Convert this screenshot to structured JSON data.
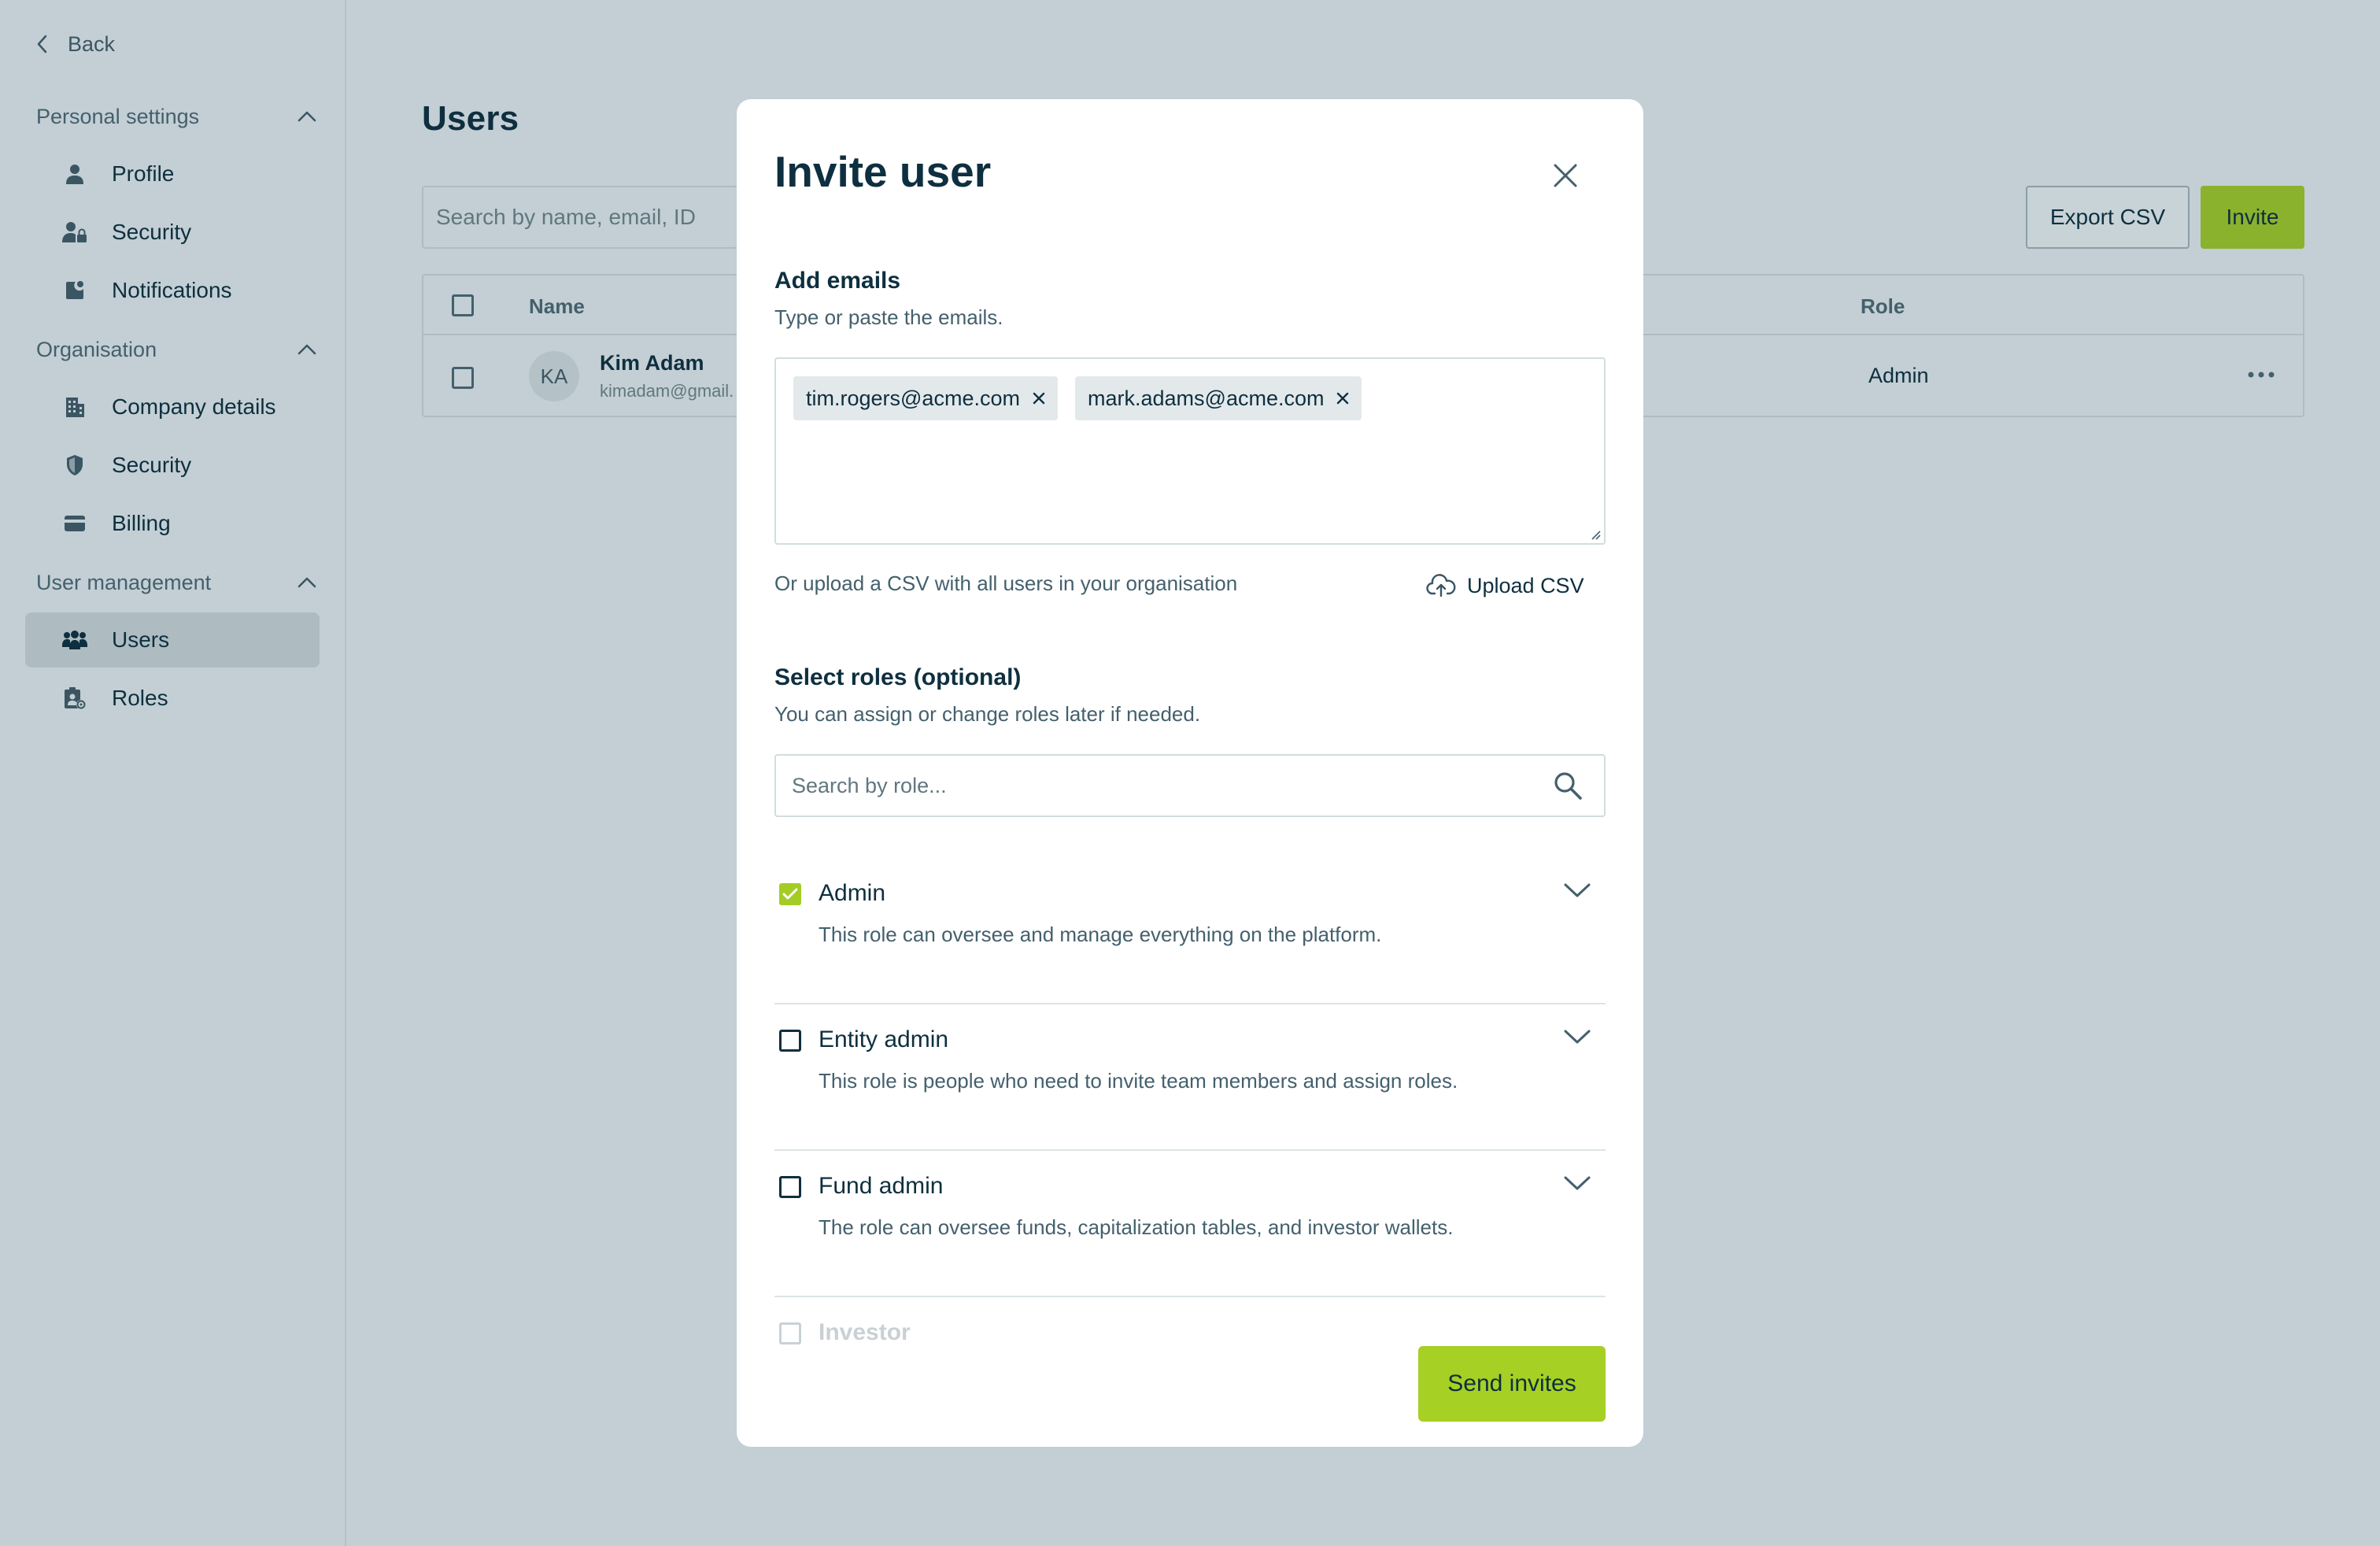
{
  "sidebar": {
    "back_label": "Back",
    "sections": [
      {
        "title": "Personal settings",
        "items": [
          {
            "label": "Profile",
            "icon": "person-icon"
          },
          {
            "label": "Security",
            "icon": "user-lock-icon"
          },
          {
            "label": "Notifications",
            "icon": "notification-icon"
          }
        ]
      },
      {
        "title": "Organisation",
        "items": [
          {
            "label": "Company details",
            "icon": "building-icon"
          },
          {
            "label": "Security",
            "icon": "shield-icon"
          },
          {
            "label": "Billing",
            "icon": "card-icon"
          }
        ]
      },
      {
        "title": "User management",
        "items": [
          {
            "label": "Users",
            "icon": "users-icon",
            "active": true
          },
          {
            "label": "Roles",
            "icon": "roles-icon"
          }
        ]
      }
    ]
  },
  "main": {
    "title": "Users",
    "search_placeholder": "Search by name, email, ID",
    "export_label": "Export CSV",
    "invite_label": "Invite",
    "table": {
      "columns": {
        "name": "Name",
        "role": "Role"
      },
      "rows": [
        {
          "initials": "KA",
          "name": "Kim Adam",
          "email": "kimadam@gmail.",
          "role": "Admin"
        }
      ]
    }
  },
  "modal": {
    "title": "Invite user",
    "add_emails": {
      "label": "Add emails",
      "help": "Type or paste the emails.",
      "chips": [
        "tim.rogers@acme.com",
        "mark.adams@acme.com"
      ]
    },
    "upload": {
      "help": "Or upload a CSV with all users in your organisation",
      "button": "Upload CSV"
    },
    "roles": {
      "label": "Select roles (optional)",
      "help": "You can assign or change roles later if needed.",
      "search_placeholder": "Search by role...",
      "items": [
        {
          "name": "Admin",
          "desc": "This role can oversee and manage everything on the platform.",
          "checked": true
        },
        {
          "name": "Entity admin",
          "desc": "This role is people who need to invite team members and assign roles.",
          "checked": false
        },
        {
          "name": "Fund admin",
          "desc": "The role can oversee funds, capitalization tables, and investor wallets.",
          "checked": false
        },
        {
          "name": "Investor",
          "desc": "",
          "checked": false
        }
      ]
    },
    "send_label": "Send invites"
  },
  "colors": {
    "accent": "#a6d024",
    "accent_dimmed": "#8bb22d",
    "text": "#0e2f3f",
    "overlay_bg": "#c3cfd4"
  }
}
